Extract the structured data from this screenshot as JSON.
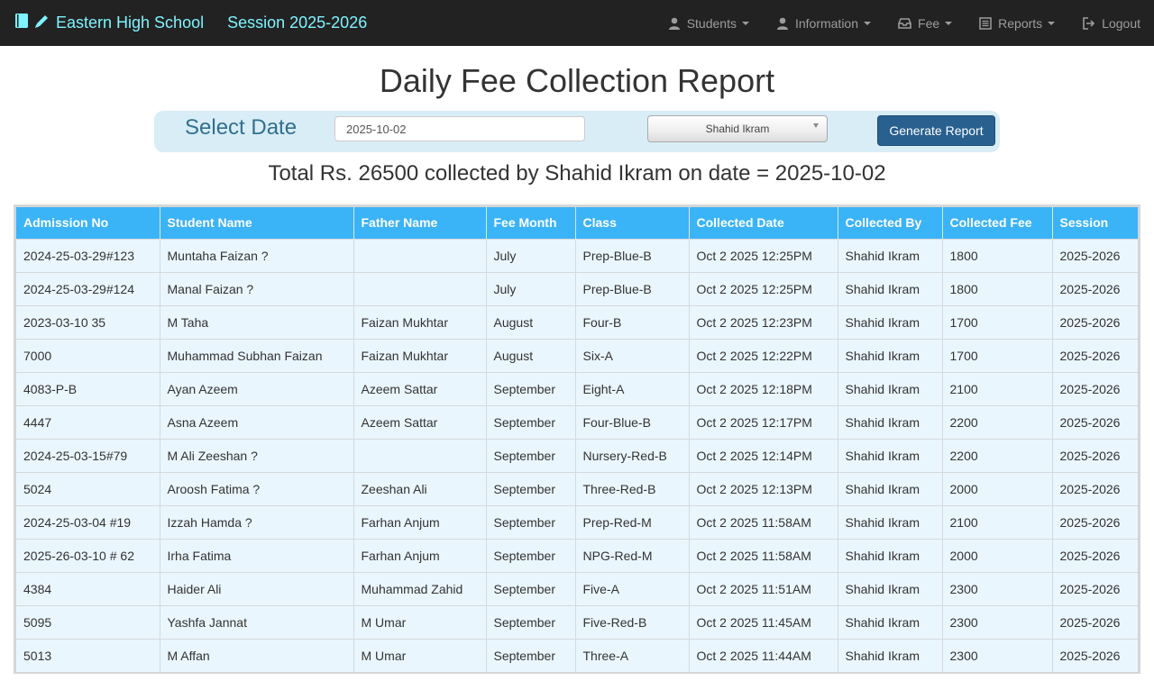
{
  "navbar": {
    "school_name": "Eastern High School",
    "session": "Session 2025-2026",
    "menu": [
      {
        "label": "Students",
        "icon": "user-icon",
        "dropdown": true
      },
      {
        "label": "Information",
        "icon": "user-icon",
        "dropdown": true
      },
      {
        "label": "Fee",
        "icon": "inbox-icon",
        "dropdown": true
      },
      {
        "label": "Reports",
        "icon": "list-alt-icon",
        "dropdown": true
      },
      {
        "label": "Logout",
        "icon": "logout-icon",
        "dropdown": false
      }
    ]
  },
  "page": {
    "title": "Daily Fee Collection Report"
  },
  "filter": {
    "label": "Select Date",
    "date_value": "2025-10-02",
    "collector_selected": "Shahid Ikram",
    "generate_label": "Generate Report"
  },
  "summary": "Total Rs. 26500 collected by Shahid Ikram on date = 2025-10-02",
  "table": {
    "headers": [
      "Admission No",
      "Student Name",
      "Father Name",
      "Fee Month",
      "Class",
      "Collected Date",
      "Collected By",
      "Collected Fee",
      "Session"
    ],
    "rows": [
      [
        "2024-25-03-29#123",
        "Muntaha Faizan ?",
        "",
        "July",
        "Prep-Blue-B",
        "Oct 2 2025 12:25PM",
        "Shahid Ikram",
        "1800",
        "2025-2026"
      ],
      [
        "2024-25-03-29#124",
        "Manal Faizan ?",
        "",
        "July",
        "Prep-Blue-B",
        "Oct 2 2025 12:25PM",
        "Shahid Ikram",
        "1800",
        "2025-2026"
      ],
      [
        "2023-03-10 35",
        "M Taha",
        "Faizan Mukhtar",
        "August",
        "Four-B",
        "Oct 2 2025 12:23PM",
        "Shahid Ikram",
        "1700",
        "2025-2026"
      ],
      [
        "7000",
        "Muhammad Subhan Faizan",
        "Faizan Mukhtar",
        "August",
        "Six-A",
        "Oct 2 2025 12:22PM",
        "Shahid Ikram",
        "1700",
        "2025-2026"
      ],
      [
        "4083-P-B",
        "Ayan Azeem",
        "Azeem Sattar",
        "September",
        "Eight-A",
        "Oct 2 2025 12:18PM",
        "Shahid Ikram",
        "2100",
        "2025-2026"
      ],
      [
        "4447",
        "Asna Azeem",
        "Azeem Sattar",
        "September",
        "Four-Blue-B",
        "Oct 2 2025 12:17PM",
        "Shahid Ikram",
        "2200",
        "2025-2026"
      ],
      [
        "2024-25-03-15#79",
        "M Ali Zeeshan ?",
        "",
        "September",
        "Nursery-Red-B",
        "Oct 2 2025 12:14PM",
        "Shahid Ikram",
        "2200",
        "2025-2026"
      ],
      [
        "5024",
        "Aroosh Fatima ?",
        "Zeeshan Ali",
        "September",
        "Three-Red-B",
        "Oct 2 2025 12:13PM",
        "Shahid Ikram",
        "2000",
        "2025-2026"
      ],
      [
        "2024-25-03-04 #19",
        "Izzah Hamda ?",
        "Farhan Anjum",
        "September",
        "Prep-Red-M",
        "Oct 2 2025 11:58AM",
        "Shahid Ikram",
        "2100",
        "2025-2026"
      ],
      [
        "2025-26-03-10 # 62",
        "Irha Fatima",
        "Farhan Anjum",
        "September",
        "NPG-Red-M",
        "Oct 2 2025 11:58AM",
        "Shahid Ikram",
        "2000",
        "2025-2026"
      ],
      [
        "4384",
        "Haider Ali",
        "Muhammad Zahid",
        "September",
        "Five-A",
        "Oct 2 2025 11:51AM",
        "Shahid Ikram",
        "2300",
        "2025-2026"
      ],
      [
        "5095",
        "Yashfa Jannat",
        "M Umar",
        "September",
        "Five-Red-B",
        "Oct 2 2025 11:45AM",
        "Shahid Ikram",
        "2300",
        "2025-2026"
      ],
      [
        "5013",
        "M Affan",
        "M Umar",
        "September",
        "Three-A",
        "Oct 2 2025 11:44AM",
        "Shahid Ikram",
        "2300",
        "2025-2026"
      ]
    ]
  },
  "colors": {
    "navbar_bg": "#222222",
    "brand_text": "#7ff3ff",
    "table_header_bg": "#3bb3f7",
    "table_row_bg": "#eaf6fd",
    "filter_bg": "#d9edf7",
    "primary_button": "#286090"
  }
}
